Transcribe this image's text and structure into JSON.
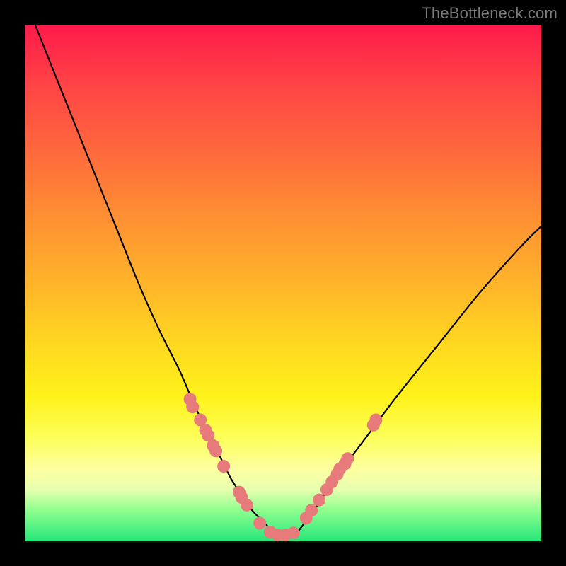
{
  "watermark": "TheBottleneck.com",
  "chart_data": {
    "type": "line",
    "title": "",
    "xlabel": "",
    "ylabel": "",
    "xlim": [
      0,
      100
    ],
    "ylim": [
      0,
      100
    ],
    "series": [
      {
        "name": "bottleneck-curve",
        "x": [
          2,
          6,
          10,
          14,
          18,
          22,
          26,
          30,
          33,
          36,
          38,
          40,
          42,
          44,
          46,
          48,
          50,
          52,
          56,
          60,
          66,
          72,
          80,
          88,
          96,
          100
        ],
        "values": [
          100,
          90,
          80,
          70,
          60,
          50,
          41,
          33,
          26,
          20,
          16,
          12,
          9,
          6,
          4,
          2,
          1,
          1,
          6,
          12,
          20,
          28,
          38,
          48,
          57,
          61
        ]
      }
    ],
    "overlay_dots": {
      "name": "highlight-dots",
      "color": "#e77a7a",
      "radius_px": 9,
      "points": [
        {
          "x": 32.0,
          "y": 27.5
        },
        {
          "x": 32.5,
          "y": 26.0
        },
        {
          "x": 34.0,
          "y": 23.5
        },
        {
          "x": 35.0,
          "y": 21.5
        },
        {
          "x": 35.5,
          "y": 20.5
        },
        {
          "x": 36.5,
          "y": 18.5
        },
        {
          "x": 37.0,
          "y": 17.5
        },
        {
          "x": 38.5,
          "y": 14.5
        },
        {
          "x": 41.5,
          "y": 9.5
        },
        {
          "x": 42.0,
          "y": 8.5
        },
        {
          "x": 43.0,
          "y": 7.0
        },
        {
          "x": 45.5,
          "y": 3.5
        },
        {
          "x": 47.5,
          "y": 1.8
        },
        {
          "x": 49.0,
          "y": 1.2
        },
        {
          "x": 50.5,
          "y": 1.2
        },
        {
          "x": 52.0,
          "y": 1.6
        },
        {
          "x": 54.5,
          "y": 4.5
        },
        {
          "x": 55.5,
          "y": 6.0
        },
        {
          "x": 57.0,
          "y": 8.0
        },
        {
          "x": 58.5,
          "y": 10.0
        },
        {
          "x": 59.5,
          "y": 11.5
        },
        {
          "x": 60.5,
          "y": 13.0
        },
        {
          "x": 61.0,
          "y": 14.0
        },
        {
          "x": 62.0,
          "y": 15.0
        },
        {
          "x": 62.5,
          "y": 16.0
        },
        {
          "x": 67.5,
          "y": 22.5
        },
        {
          "x": 68.0,
          "y": 23.5
        }
      ]
    },
    "gradient_stops": [
      {
        "pos": 0.0,
        "color": "#ff1a4b"
      },
      {
        "pos": 0.12,
        "color": "#ff4545"
      },
      {
        "pos": 0.25,
        "color": "#ff6a3c"
      },
      {
        "pos": 0.37,
        "color": "#ff8f33"
      },
      {
        "pos": 0.5,
        "color": "#ffb42a"
      },
      {
        "pos": 0.62,
        "color": "#ffd820"
      },
      {
        "pos": 0.72,
        "color": "#fff21a"
      },
      {
        "pos": 0.8,
        "color": "#fdff5a"
      },
      {
        "pos": 0.86,
        "color": "#fdffa0"
      },
      {
        "pos": 0.9,
        "color": "#e7ffb0"
      },
      {
        "pos": 0.94,
        "color": "#8eff8e"
      },
      {
        "pos": 1.0,
        "color": "#25e67a"
      }
    ]
  }
}
